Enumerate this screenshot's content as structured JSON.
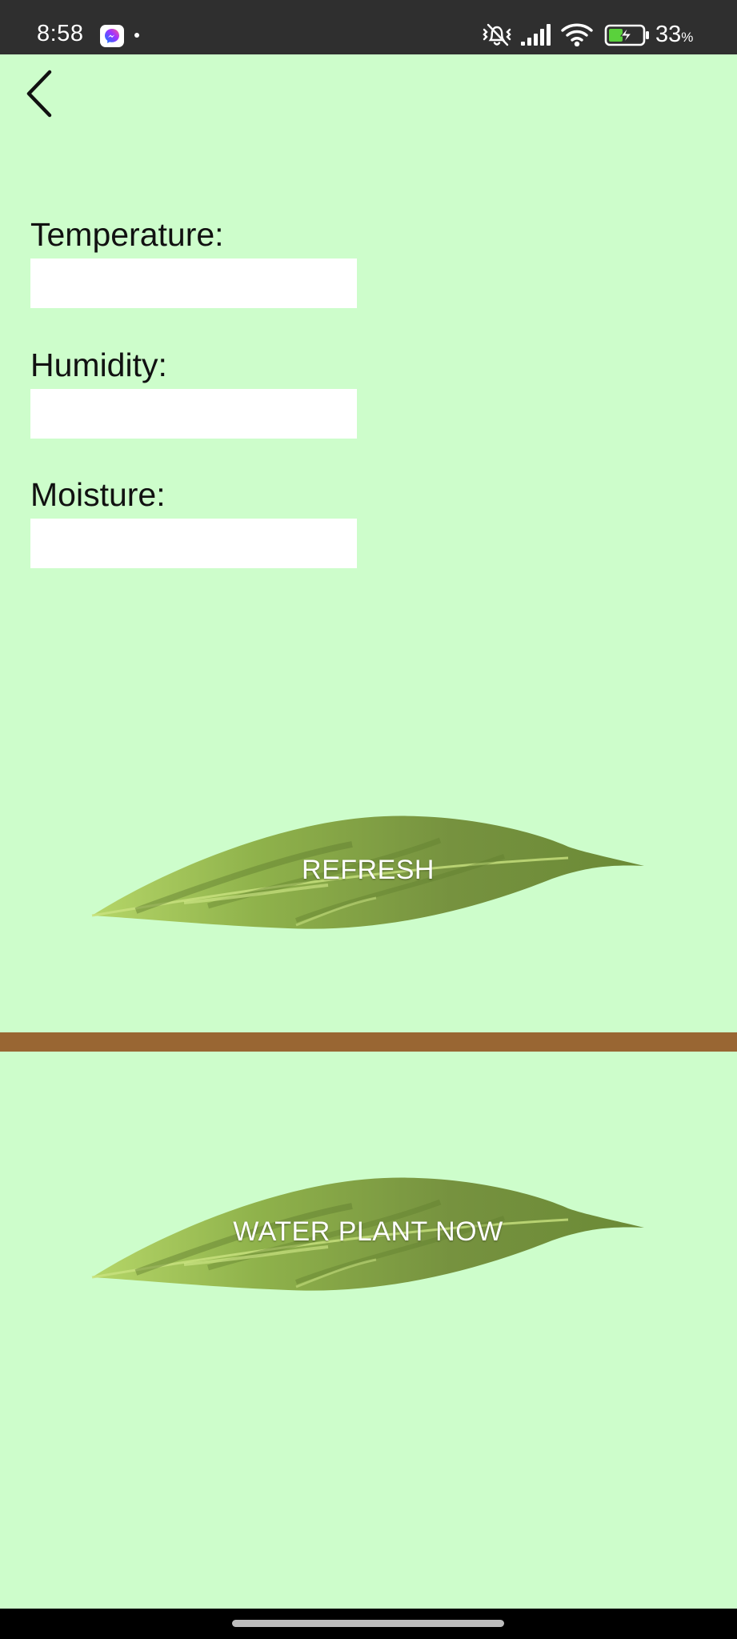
{
  "status_bar": {
    "time": "8:58",
    "battery_percent": "33",
    "battery_percent_sign": "%",
    "icons": [
      "messenger-icon",
      "notification-dot",
      "vibrate-off-icon",
      "signal-icon",
      "wifi-icon",
      "battery-charging-icon"
    ]
  },
  "header": {
    "back_icon": "chevron-left-icon"
  },
  "fields": [
    {
      "label": "Temperature:",
      "value": ""
    },
    {
      "label": "Humidity:",
      "value": ""
    },
    {
      "label": "Moisture:",
      "value": ""
    }
  ],
  "buttons": {
    "refresh_label": "REFRESH",
    "water_label": "WATER PLANT NOW"
  },
  "colors": {
    "background": "#cdfdcb",
    "divider": "#996633",
    "leaf_dark": "#76923f",
    "leaf_light": "#a9cc5e"
  }
}
